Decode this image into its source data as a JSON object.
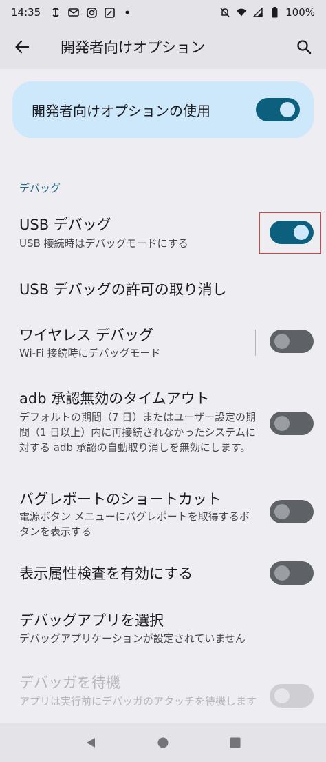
{
  "status_bar": {
    "time": "14:35",
    "battery": "100%"
  },
  "app_bar": {
    "title": "開発者向けオプション"
  },
  "main_switch": {
    "label": "開発者向けオプションの使用",
    "checked": true
  },
  "section": {
    "header": "デバッグ"
  },
  "preferences": [
    {
      "title": "USB デバッグ",
      "summary": "USB 接続時はデバッグモードにする",
      "toggle": "on"
    },
    {
      "title": "USB デバッグの許可の取り消し",
      "summary": ""
    },
    {
      "title": "ワイヤレス デバッグ",
      "summary": "Wi-Fi 接続時にデバッグモード",
      "toggle": "off"
    },
    {
      "title": "adb 承認無効のタイムアウト",
      "summary": "デフォルトの期間（7 日）またはユーザー設定の期間（1 日以上）内に再接続されなかったシステムに対する adb 承認の自動取り消しを無効にします。",
      "toggle": "off"
    },
    {
      "title": "バグレポートのショートカット",
      "summary": "電源ボタン メニューにバグレポートを取得するボタンを表示する",
      "toggle": "off"
    },
    {
      "title": "表示属性検査を有効にする",
      "summary": "",
      "toggle": "off"
    },
    {
      "title": "デバッグアプリを選択",
      "summary": "デバッグアプリケーションが設定されていません"
    },
    {
      "title": "デバッガを待機",
      "summary": "アプリは実行前にデバッガのアタッチを待機します",
      "toggle": "disabled"
    }
  ],
  "colors": {
    "accent": "#0d607d",
    "card": "#cde8fb",
    "background": "#eeedf2",
    "highlight": "#d8423f"
  },
  "icons": [
    "back-arrow-icon",
    "search-icon",
    "nav-back-icon",
    "nav-home-icon",
    "nav-recents-icon"
  ]
}
